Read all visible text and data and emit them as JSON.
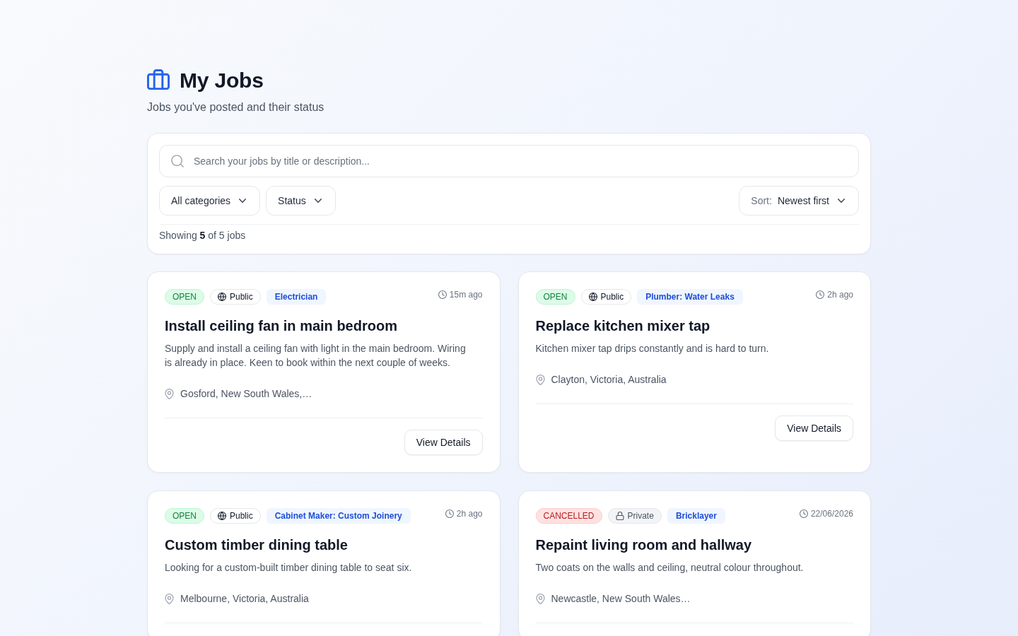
{
  "header": {
    "title": "My Jobs",
    "subtitle": "Jobs you've posted and their status"
  },
  "filters": {
    "search": {
      "placeholder": "Search your jobs by title or description..."
    },
    "dropdowns": [
      "All categories",
      "Status"
    ],
    "sort": {
      "label": "Sort:",
      "value": "Newest first"
    },
    "summary": "Showing **5** of 5 jobs"
  },
  "jobs": [
    {
      "status": {
        "label": "OPEN",
        "kind": "open"
      },
      "visibility": {
        "label": "Public",
        "kind": "public"
      },
      "category": "Electrician",
      "posted": "15m ago",
      "title": "Install ceiling fan in main bedroom",
      "description": "Supply and install a ceiling fan with light in the main bedroom. Wiring is already in place. Keen to book within the next couple of weeks.",
      "location": "Gosford, New South Wales,…",
      "button": "View Details"
    },
    {
      "status": {
        "label": "OPEN",
        "kind": "open"
      },
      "visibility": {
        "label": "Public",
        "kind": "public"
      },
      "category": "Plumber: Water Leaks",
      "posted": "2h ago",
      "title": "Replace kitchen mixer tap",
      "description": "Kitchen mixer tap drips constantly and is hard to turn.",
      "location": "Clayton, Victoria, Australia",
      "button": "View Details"
    },
    {
      "status": {
        "label": "OPEN",
        "kind": "open"
      },
      "visibility": {
        "label": "Public",
        "kind": "public"
      },
      "category": "Cabinet Maker: Custom Joinery",
      "posted": "2h ago",
      "title": "Custom timber dining table",
      "description": "Looking for a custom-built timber dining table to seat six.",
      "location": "Melbourne, Victoria, Australia"
    },
    {
      "status": {
        "label": "CANCELLED",
        "kind": "cancelled"
      },
      "visibility": {
        "label": "Private",
        "kind": "private"
      },
      "category": "Bricklayer",
      "posted": "22/06/2026",
      "title": "Repaint living room and hallway",
      "description": "Two coats on the walls and ceiling, neutral colour throughout.",
      "location": "Newcastle, New South Wales…"
    }
  ]
}
